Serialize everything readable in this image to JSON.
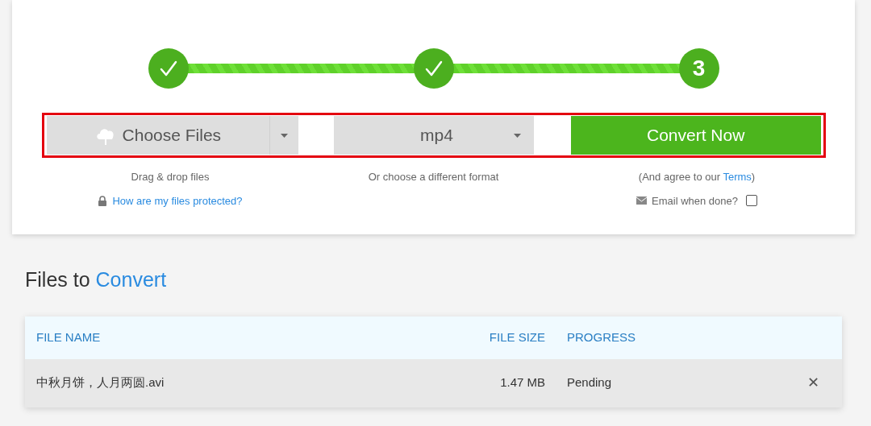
{
  "steps": [
    {
      "kind": "done"
    },
    {
      "kind": "done"
    },
    {
      "kind": "current",
      "label": "3"
    }
  ],
  "controls": {
    "highlighted": true,
    "choose_files": "Choose Files",
    "format": "mp4",
    "convert": "Convert Now"
  },
  "hints": {
    "drag_drop": "Drag & drop files",
    "protected_link": "How are my files protected?",
    "format_hint": "Or choose a different format",
    "terms_before": "(And agree to our ",
    "terms_link": "Terms",
    "terms_after": ")",
    "email_label": "Email when done?",
    "email_checked": false
  },
  "section_title": {
    "text": "Files to",
    "highlight": "Convert"
  },
  "table": {
    "columns": [
      "FILE NAME",
      "FILE SIZE",
      "PROGRESS"
    ],
    "rows": [
      {
        "name": "中秋月饼，人月两圆.avi",
        "size": "1.47 MB",
        "progress": "Pending",
        "remove": "✕"
      }
    ]
  }
}
